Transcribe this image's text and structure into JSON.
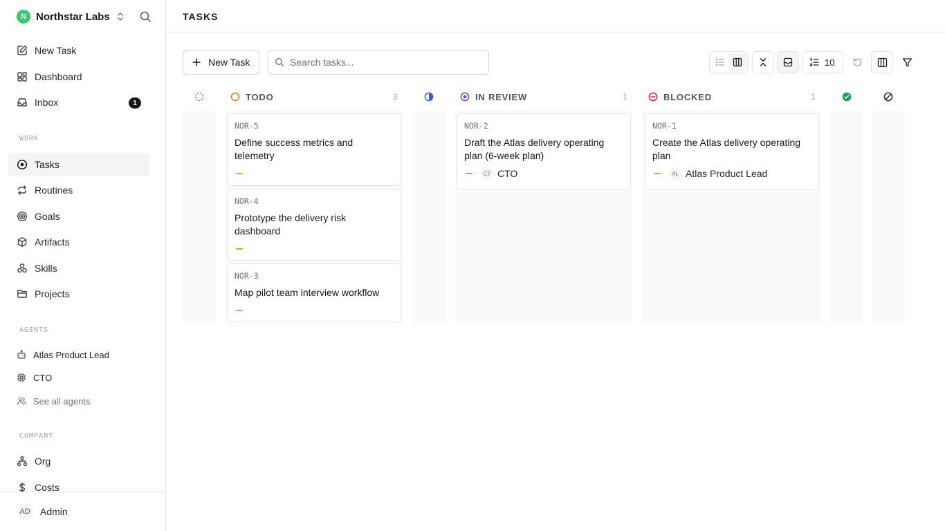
{
  "sidebar": {
    "brand": {
      "name": "Northstar Labs",
      "initial": "N"
    },
    "top_items": [
      {
        "label": "New Task",
        "icon": "edit-icon"
      },
      {
        "label": "Dashboard",
        "icon": "dashboard-icon"
      },
      {
        "label": "Inbox",
        "icon": "inbox-icon",
        "badge": "1"
      }
    ],
    "work_label": "WORK",
    "work_items": [
      {
        "label": "Tasks",
        "icon": "circle-dot-icon",
        "active": true
      },
      {
        "label": "Routines",
        "icon": "repeat-icon"
      },
      {
        "label": "Goals",
        "icon": "target-icon"
      },
      {
        "label": "Artifacts",
        "icon": "box-icon"
      },
      {
        "label": "Skills",
        "icon": "skills-icon"
      },
      {
        "label": "Projects",
        "icon": "folder-icon"
      }
    ],
    "agents_label": "AGENTS",
    "agents": [
      {
        "label": "Atlas Product Lead",
        "icon": "bot-icon"
      },
      {
        "label": "CTO",
        "icon": "cpu-icon"
      }
    ],
    "see_all_agents": "See all agents",
    "company_label": "COMPANY",
    "company_items": [
      {
        "label": "Org",
        "icon": "org-icon"
      },
      {
        "label": "Costs",
        "icon": "dollar-icon"
      }
    ],
    "user": {
      "initials": "AD",
      "name": "Admin"
    }
  },
  "header": {
    "title": "TASKS"
  },
  "toolbar": {
    "new_task_label": "New Task",
    "search_placeholder": "Search tasks...",
    "limit_value": "10"
  },
  "board": {
    "todo": {
      "title": "TODO",
      "count": "3"
    },
    "in_review": {
      "title": "IN REVIEW",
      "count": "1"
    },
    "blocked": {
      "title": "BLOCKED",
      "count": "1"
    },
    "cards": {
      "c1": {
        "id": "NOR-5",
        "title": "Define success metrics and telemetry"
      },
      "c2": {
        "id": "NOR-4",
        "title": "Prototype the delivery risk dashboard"
      },
      "c3": {
        "id": "NOR-3",
        "title": "Map pilot team interview workflow"
      },
      "c4": {
        "id": "NOR-2",
        "title": "Draft the Atlas delivery operating plan (6-week plan)",
        "assignee_initials": "CT",
        "assignee": "CTO"
      },
      "c5": {
        "id": "NOR-1",
        "title": "Create the Atlas delivery operating plan",
        "assignee_initials": "AL",
        "assignee": "Atlas Product Lead"
      }
    }
  },
  "colors": {
    "todo": "#d97706",
    "in_progress": "#3b5bdb",
    "in_review": "#7c3aed",
    "blocked": "#dc2626",
    "done": "#16a34a",
    "priority": "#e0a040"
  }
}
